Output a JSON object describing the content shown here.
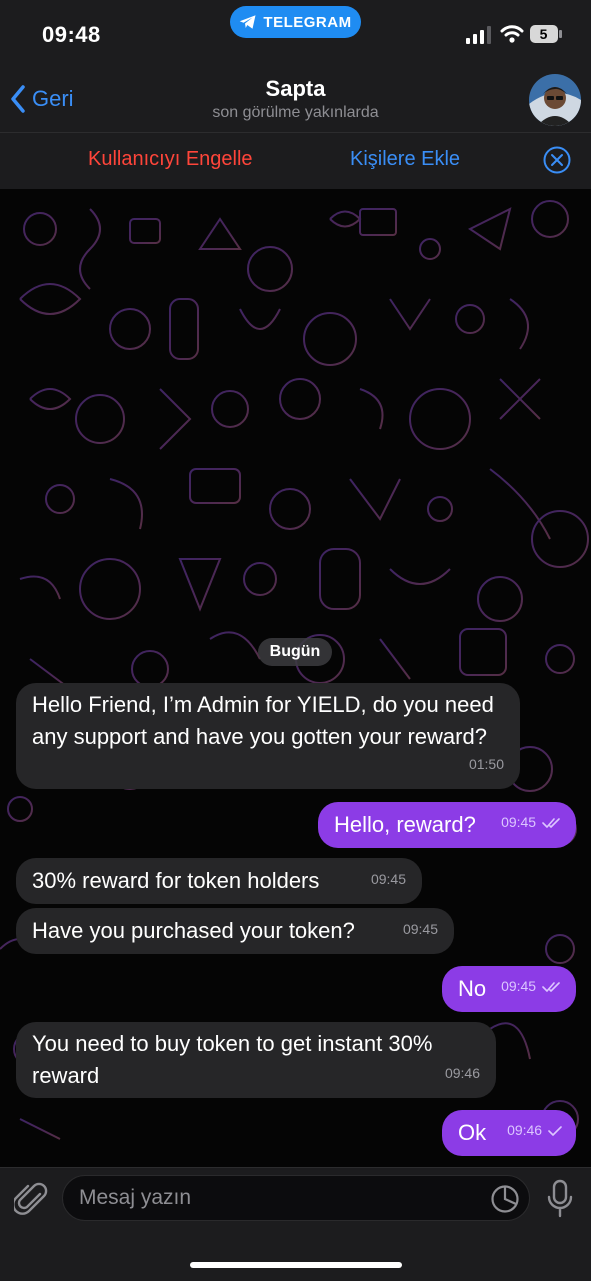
{
  "status": {
    "time": "09:48",
    "app_pill": "TELEGRAM",
    "battery": "5"
  },
  "header": {
    "back_label": "Geri",
    "title": "Sapta",
    "subtitle": "son görülme yakınlarda"
  },
  "actions": {
    "block": "Kullanıcıyı Engelle",
    "add_contact": "Kişilere Ekle"
  },
  "chat": {
    "date": "Bugün",
    "messages": [
      {
        "dir": "in",
        "text": "Hello Friend, I’m Admin for YIELD, do you need any support and have you gotten your reward?",
        "time": "01:50"
      },
      {
        "dir": "out",
        "text": "Hello, reward?",
        "time": "09:45",
        "status": "read"
      },
      {
        "dir": "in",
        "text": "30% reward for token holders",
        "time": "09:45"
      },
      {
        "dir": "in",
        "text": "Have you purchased your token?",
        "time": "09:45"
      },
      {
        "dir": "out",
        "text": "No",
        "time": "09:45",
        "status": "read"
      },
      {
        "dir": "in",
        "text": "You need to buy token to get instant 30% reward",
        "time": "09:46"
      },
      {
        "dir": "out",
        "text": "Ok",
        "time": "09:46",
        "status": "sent"
      }
    ]
  },
  "composer": {
    "placeholder": "Mesaj yazın"
  },
  "colors": {
    "accent": "#3a8ef6",
    "danger": "#ff453a",
    "outgoing_bubble": "#8c3ce6",
    "incoming_bubble": "#262628"
  },
  "icons": [
    "telegram-icon",
    "back-chevron-icon",
    "close-icon",
    "attach-icon",
    "sticker-icon",
    "mic-icon",
    "double-check-icon",
    "check-icon"
  ]
}
